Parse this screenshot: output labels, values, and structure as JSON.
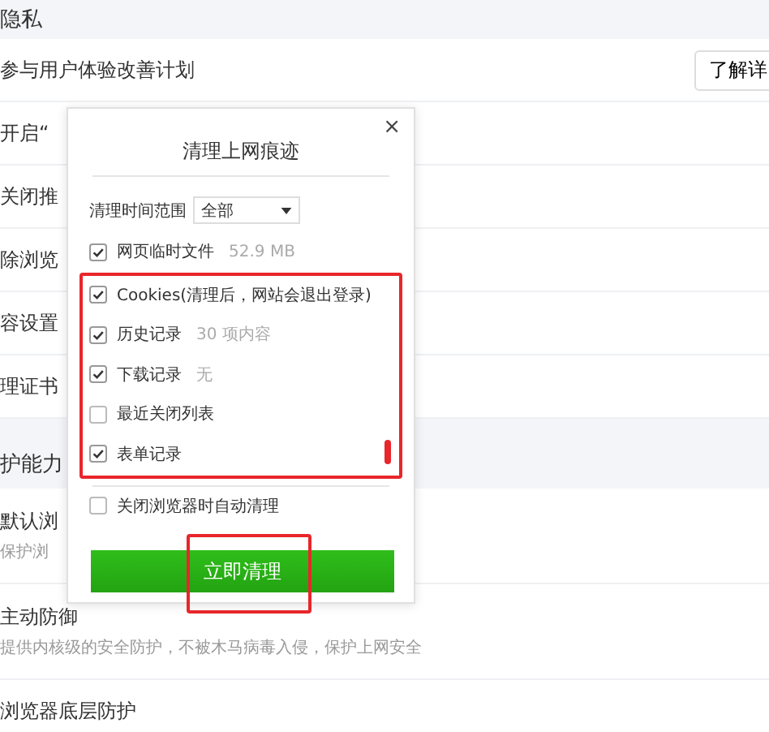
{
  "sections": [
    {
      "title": "隐私",
      "rows": [
        {
          "label": "参与用户体验改善计划",
          "button": "了解详"
        },
        {
          "label": "开启“"
        },
        {
          "label": "关闭推"
        },
        {
          "label": "除浏览"
        },
        {
          "label": "容设置"
        },
        {
          "label": "理证书"
        }
      ]
    },
    {
      "title": "护能力",
      "rows": [
        {
          "label": "默认浏",
          "description": "保护浏"
        },
        {
          "label": "主动防御",
          "description": "提供内核级的安全防护，不被木马病毒入侵，保护上网安全"
        },
        {
          "label": "浏览器底层防护"
        }
      ]
    }
  ],
  "dialog": {
    "title": "清理上网痕迹",
    "close": "×",
    "time_range": {
      "label": "清理时间范围",
      "value": "全部"
    },
    "items": [
      {
        "label": "网页临时文件",
        "detail": "52.9 MB",
        "checked": true,
        "highlighted": false
      },
      {
        "label": "Cookies(清理后，网站会退出登录)",
        "checked": true,
        "highlighted": true
      },
      {
        "label": "历史记录",
        "detail": "30 项内容",
        "checked": true,
        "highlighted": true
      },
      {
        "label": "下载记录",
        "detail": "无",
        "checked": true,
        "highlighted": true
      },
      {
        "label": "最近关闭列表",
        "checked": false,
        "highlighted": true
      },
      {
        "label": "表单记录",
        "checked": true,
        "highlighted": true
      }
    ],
    "auto_clean": {
      "label": "关闭浏览器时自动清理",
      "checked": false
    },
    "button": {
      "label": "立即清理",
      "highlighted": true
    }
  }
}
